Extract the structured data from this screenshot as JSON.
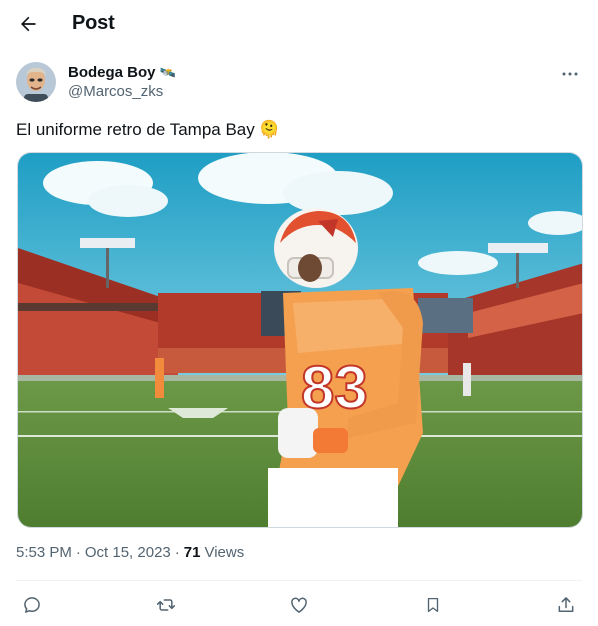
{
  "header": {
    "title": "Post",
    "back_icon": "arrow-left-icon"
  },
  "author": {
    "display_name": "Bodega Boy",
    "badge_emoji": "🛰️",
    "handle": "@Marcos_zks",
    "avatar_icon": "profile-photo"
  },
  "tweet": {
    "text": "El uniforme retro de Tampa Bay",
    "emoji": "🫠"
  },
  "media": {
    "description_icon": "football-player-photo",
    "jersey_number": "83"
  },
  "meta": {
    "time": "5:53 PM",
    "sep1": "·",
    "date": "Oct 15, 2023",
    "sep2": "·",
    "views_count": "71",
    "views_label": "Views"
  },
  "actions": {
    "reply_icon": "reply-icon",
    "retweet_icon": "retweet-icon",
    "like_icon": "heart-icon",
    "bookmark_icon": "bookmark-icon",
    "share_icon": "share-icon"
  },
  "colors": {
    "text": "#0f1419",
    "secondary": "#536471",
    "divider": "#eff3f4",
    "jersey_orange": "#f28b3b",
    "sky": "#2da9c8",
    "field": "#5f8f3c"
  }
}
